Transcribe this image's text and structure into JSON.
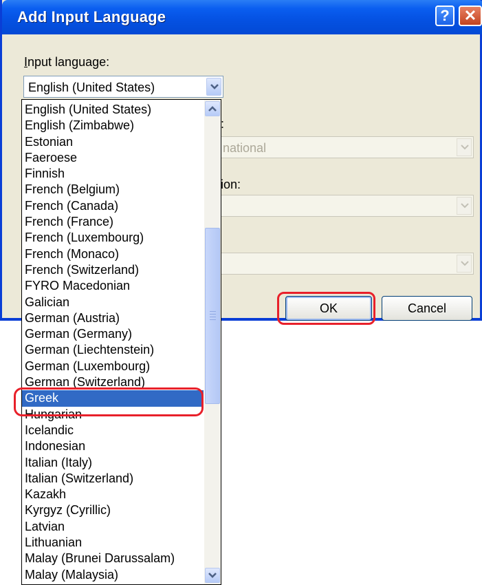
{
  "dialog": {
    "title": "Add Input Language",
    "help_glyph": "?",
    "close_glyph": "✕",
    "input_language_label_accel": "I",
    "input_language_label_rest": "nput language:",
    "input_language_value": "English (United States)",
    "hidden_label_1": ":",
    "hidden_value_1": "national",
    "hidden_label_2": "ion:",
    "ok_label": "OK",
    "cancel_label": "Cancel"
  },
  "language_list": {
    "items": [
      "English (United States)",
      "English (Zimbabwe)",
      "Estonian",
      "Faeroese",
      "Finnish",
      "French (Belgium)",
      "French (Canada)",
      "French (France)",
      "French (Luxembourg)",
      "French (Monaco)",
      "French (Switzerland)",
      "FYRO Macedonian",
      "Galician",
      "German (Austria)",
      "German (Germany)",
      "German (Liechtenstein)",
      "German (Luxembourg)",
      "German (Switzerland)",
      "Greek",
      "Hungarian",
      "Icelandic",
      "Indonesian",
      "Italian (Italy)",
      "Italian (Switzerland)",
      "Kazakh",
      "Kyrgyz (Cyrillic)",
      "Latvian",
      "Lithuanian",
      "Malay (Brunei Darussalam)",
      "Malay (Malaysia)"
    ],
    "selected": "Greek"
  },
  "icons": {
    "dropdown": "chevron-down-icon",
    "scroll_up": "chevron-up-icon",
    "scroll_down": "chevron-down-icon",
    "help": "help-icon",
    "close": "close-icon"
  },
  "colors": {
    "title_bar": "#0552e3",
    "dialog_face": "#ece9d8",
    "selection": "#316ac5",
    "annotation": "#e8202a"
  }
}
